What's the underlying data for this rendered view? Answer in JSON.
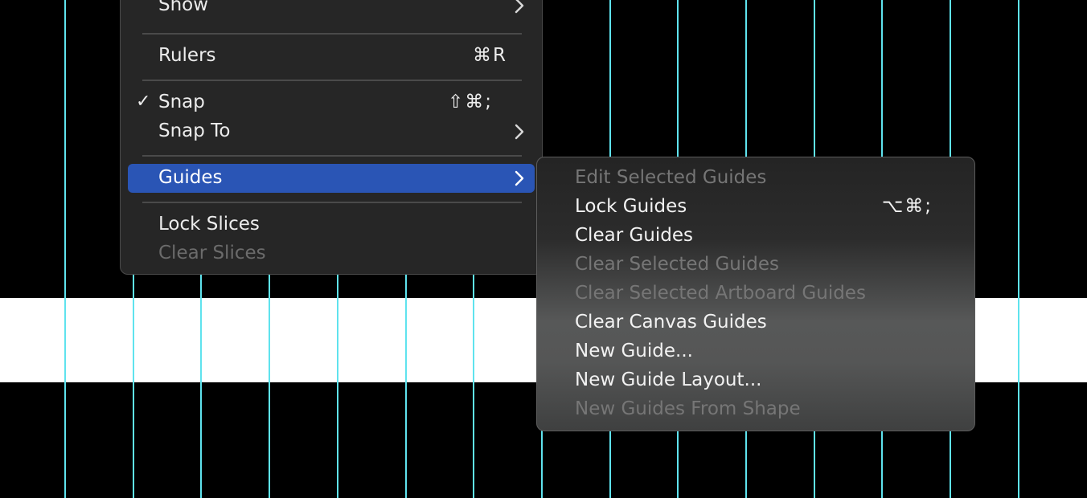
{
  "canvas": {
    "background": "#000000",
    "band_color": "#ffffff",
    "guide_color": "#5fe3ee"
  },
  "menu": {
    "items": [
      {
        "label": "Show",
        "shortcut": "",
        "submenu": true,
        "checked": false,
        "enabled": true
      },
      {
        "label": "Rulers",
        "shortcut": "⌘R",
        "submenu": false,
        "checked": false,
        "enabled": true
      },
      {
        "label": "Snap",
        "shortcut": "⇧⌘;",
        "submenu": false,
        "checked": true,
        "enabled": true
      },
      {
        "label": "Snap To",
        "shortcut": "",
        "submenu": true,
        "checked": false,
        "enabled": true
      },
      {
        "label": "Guides",
        "shortcut": "",
        "submenu": true,
        "checked": false,
        "enabled": true,
        "selected": true
      },
      {
        "label": "Lock Slices",
        "shortcut": "",
        "submenu": false,
        "checked": false,
        "enabled": true
      },
      {
        "label": "Clear Slices",
        "shortcut": "",
        "submenu": false,
        "checked": false,
        "enabled": false
      }
    ],
    "check_mark": "✓",
    "selected_color": "#2a55b5"
  },
  "submenu": {
    "items": [
      {
        "label": "Edit Selected Guides",
        "shortcut": "",
        "enabled": false
      },
      {
        "label": "Lock Guides",
        "shortcut": "⌥⌘;",
        "enabled": true
      },
      {
        "label": "Clear Guides",
        "shortcut": "",
        "enabled": true
      },
      {
        "label": "Clear Selected Guides",
        "shortcut": "",
        "enabled": false
      },
      {
        "label": "Clear Selected Artboard Guides",
        "shortcut": "",
        "enabled": false
      },
      {
        "label": "Clear Canvas Guides",
        "shortcut": "",
        "enabled": true
      },
      {
        "label": "New Guide...",
        "shortcut": "",
        "enabled": true
      },
      {
        "label": "New Guide Layout...",
        "shortcut": "",
        "enabled": true
      },
      {
        "label": "New Guides From Shape",
        "shortcut": "",
        "enabled": false
      }
    ]
  }
}
